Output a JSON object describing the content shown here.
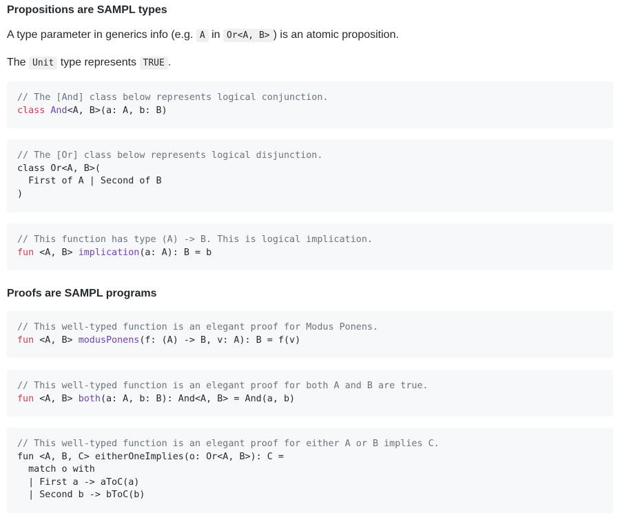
{
  "sections": [
    {
      "heading": "Propositions are SAMPL types",
      "para1": {
        "before": "A type parameter in generics info (e.g. ",
        "code1": "A",
        "middle": " in ",
        "code2": "Or<A, B>",
        "after": ") is an atomic proposition."
      },
      "para2": {
        "before": "The ",
        "code1": "Unit",
        "middle": " type represents ",
        "code2": "TRUE",
        "after": "."
      }
    },
    {
      "heading": "Proofs are SAMPL programs"
    }
  ],
  "code_blocks": {
    "and": {
      "comment": "// The [And] class below represents logical conjunction.",
      "kw": "class",
      "name": "And",
      "rest1": "<A, B>(a: A, b: B)"
    },
    "or": {
      "comment": "// The [Or] class below represents logical disjunction.",
      "line1": "class Or<A, B>(",
      "line2": "  First of A | Second of B",
      "line3": ")"
    },
    "implication": {
      "comment": "// This function has type (A) -> B. This is logical implication.",
      "kw": "fun",
      "generics": " <A, B> ",
      "name": "implication",
      "rest": "(a: A): B = b"
    },
    "modus": {
      "comment": "// This well-typed function is an elegant proof for Modus Ponens.",
      "kw": "fun",
      "generics": " <A, B> ",
      "name": "modusPonens",
      "rest": "(f: (A) -> B, v: A): B = f(v)"
    },
    "both": {
      "comment": "// This well-typed function is an elegant proof for both A and B are true.",
      "kw": "fun",
      "generics": " <A, B> ",
      "name": "both",
      "rest": "(a: A, b: B): And<A, B> = And(a, b)"
    },
    "either": {
      "comment": "// This well-typed function is an elegant proof for either A or B implies C.",
      "line1": "fun <A, B, C> eitherOneImplies(o: Or<A, B>): C =",
      "line2": "  match o with",
      "line3": "  | First a -> aToC(a)",
      "line4": "  | Second b -> bToC(b)"
    }
  }
}
